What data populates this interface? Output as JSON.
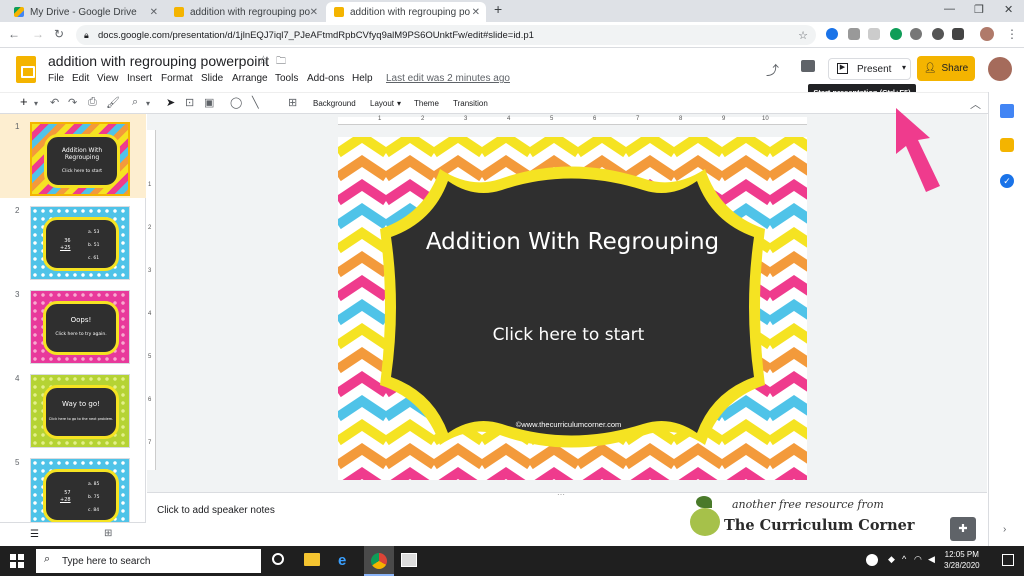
{
  "browser": {
    "tabs": [
      {
        "title": "My Drive - Google Drive",
        "active": false
      },
      {
        "title": "addition with regrouping powerpo",
        "active": false
      },
      {
        "title": "addition with regrouping powerpo",
        "active": true
      }
    ],
    "url": "docs.google.com/presentation/d/1jlnEQJ7iql7_PJeAFtmdRpbCVfyq9alM9PS6OUnktFw/edit#slide=id.p1"
  },
  "doc": {
    "title": "addition with regrouping powerpoint",
    "menu": [
      "File",
      "Edit",
      "View",
      "Insert",
      "Format",
      "Slide",
      "Arrange",
      "Tools",
      "Add-ons",
      "Help"
    ],
    "last_edit": "Last edit was 2 minutes ago",
    "present_label": "Present",
    "share_label": "Share",
    "tooltip": "Start presentation (Ctrl+F5)"
  },
  "toolbar": {
    "background": "Background",
    "layout": "Layout",
    "theme": "Theme",
    "transition": "Transition"
  },
  "ruler_numbers": [
    "1",
    "2",
    "3",
    "4",
    "5",
    "6",
    "7",
    "8",
    "9",
    "10"
  ],
  "thumbnails": [
    {
      "num": "1",
      "title": "Addition With Regrouping",
      "sub": "Click here to start",
      "bg": "chevron",
      "selected": true
    },
    {
      "num": "2",
      "lines": [
        "36",
        "+25"
      ],
      "options": [
        "a. 53",
        "b. 51",
        "c. 61"
      ],
      "bg": "#4fc3e8"
    },
    {
      "num": "3",
      "title": "Oops!",
      "sub": "Click here to try again.",
      "bg": "#e8399b"
    },
    {
      "num": "4",
      "title": "Way to go!",
      "sub": "Click here to go to the next problem.",
      "bg": "#b5d334"
    },
    {
      "num": "5",
      "lines": [
        "57",
        "+28"
      ],
      "options": [
        "a. 85",
        "b. 75",
        "c. 84"
      ],
      "bg": "#4fc3e8"
    }
  ],
  "slide": {
    "title": "Addition With Regrouping",
    "subtitle": "Click here to start",
    "credit": "©www.thecurriculumcorner.com"
  },
  "speaker_notes_placeholder": "Click to add speaker notes",
  "watermark": {
    "tagline": "another free resource from",
    "brand": "The Curriculum Corner"
  },
  "taskbar": {
    "search_placeholder": "Type here to search",
    "time": "12:05 PM",
    "date": "3/28/2020"
  },
  "colors": {
    "accent": "#f4b400",
    "chalkboard": "#2f2f2f",
    "frame": "#f5e322",
    "arrow": "#ef3b8d"
  }
}
